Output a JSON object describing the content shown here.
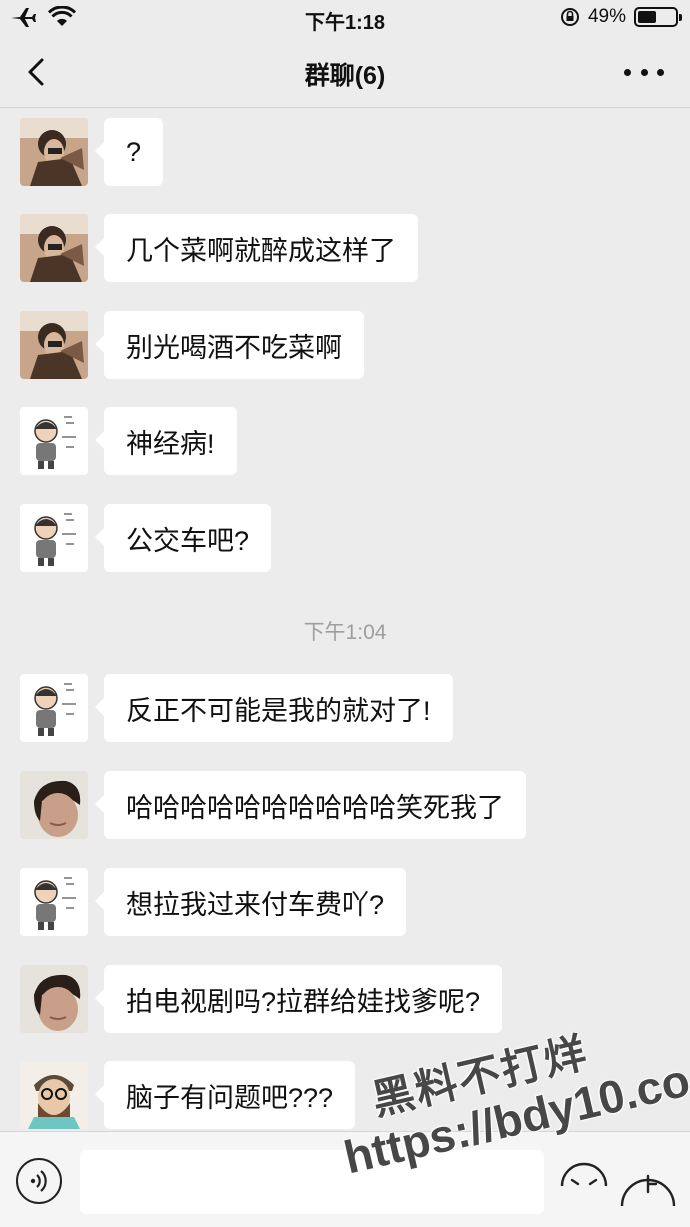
{
  "status_bar": {
    "time": "下午1:18",
    "battery": "49%",
    "battery_level": 0.49
  },
  "header": {
    "title": "群聊(6)"
  },
  "messages": [
    {
      "sender": "user-a",
      "text": "?"
    },
    {
      "sender": "user-a",
      "text": "几个菜啊就醉成这样了"
    },
    {
      "sender": "user-a",
      "text": "别光喝酒不吃菜啊"
    },
    {
      "sender": "user-b",
      "text": "神经病!"
    },
    {
      "sender": "user-b",
      "text": "公交车吧?"
    },
    {
      "sender": "user-b",
      "text": "反正不可能是我的就对了!"
    },
    {
      "sender": "user-c",
      "text": "哈哈哈哈哈哈哈哈哈哈笑死我了"
    },
    {
      "sender": "user-b",
      "text": "想拉我过来付车费吖?"
    },
    {
      "sender": "user-c",
      "text": "拍电视剧吗?拉群给娃找爹呢?"
    },
    {
      "sender": "user-d",
      "text": "脑子有问题吧???"
    }
  ],
  "timestamp_separator": "下午1:04",
  "input_bar": {
    "value": ""
  },
  "watermark": {
    "line1": "黑料不打烊",
    "line2": "https://bdy10.co"
  },
  "icons": {
    "airplane": "airplane-icon",
    "wifi": "wifi-icon",
    "lock": "orientation-lock-icon",
    "back": "back-icon",
    "more": "more-icon",
    "voice": "voice-icon",
    "emoji": "emoji-icon",
    "plus": "plus-icon"
  },
  "colors": {
    "background": "#ececec",
    "bubble": "#ffffff",
    "timestamp": "#9e9e9e"
  }
}
